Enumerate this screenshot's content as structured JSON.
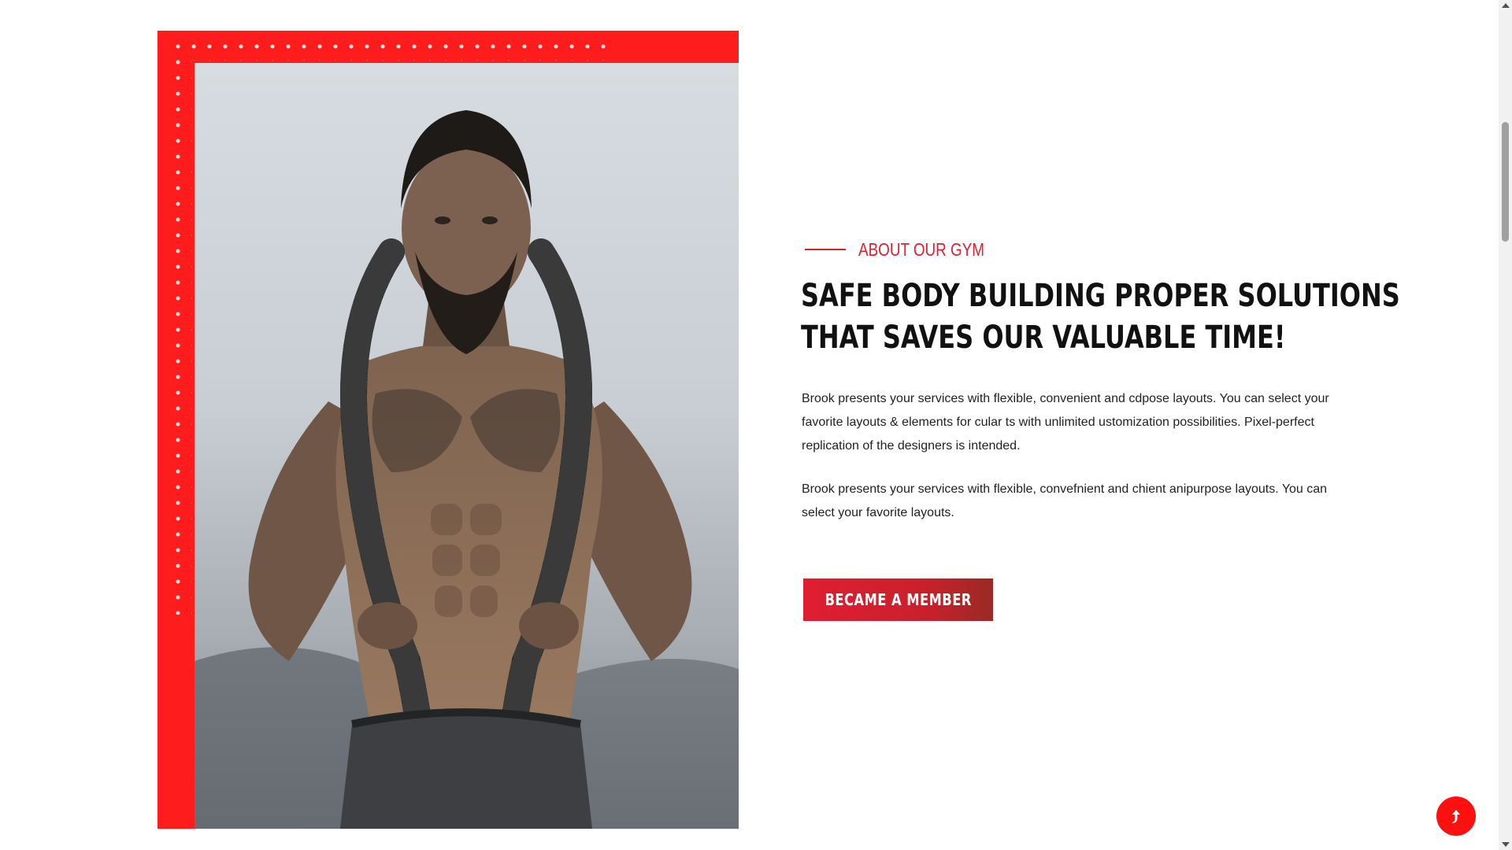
{
  "about": {
    "subtitle": "ABOUT OUR GYM",
    "heading_line1": "SAFE BODY BUILDING PROPER SOLUTIONS",
    "heading_line2": "THAT SAVES OUR VALUABLE TIME!",
    "paragraph1": "Brook presents your services with flexible, convenient and cdpose layouts. You can select your favorite layouts & elements for cular ts with unlimited ustomization possibilities. Pixel-perfect replication of the designers is intended.",
    "paragraph2": "Brook presents your services with flexible, convefnient and chient anipurpose layouts. You can select your favorite layouts.",
    "button_label": "BECAME A MEMBER"
  },
  "image": {
    "subject": "tattooed bodybuilder with battle rope over shoulders",
    "frame_color": "#ff1c1c"
  },
  "back_to_top": {
    "icon": "arrow-up-icon"
  },
  "colors": {
    "accent": "#e01e32",
    "heading": "#111111",
    "body_text": "#222222",
    "back_to_top": "#ff1010"
  }
}
